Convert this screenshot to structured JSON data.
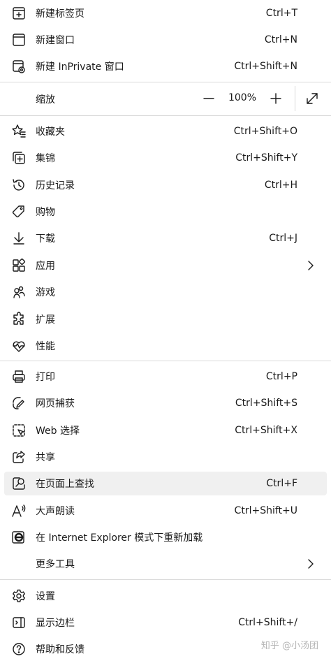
{
  "items": [
    {
      "label": "新建标签页",
      "shortcut": "Ctrl+T",
      "icon": "new-tab-icon"
    },
    {
      "label": "新建窗口",
      "shortcut": "Ctrl+N",
      "icon": "new-window-icon"
    },
    {
      "label": "新建 InPrivate 窗口",
      "shortcut": "Ctrl+Shift+N",
      "icon": "inprivate-icon"
    },
    {
      "label": "收藏夹",
      "shortcut": "Ctrl+Shift+O",
      "icon": "favorites-icon"
    },
    {
      "label": "集锦",
      "shortcut": "Ctrl+Shift+Y",
      "icon": "collections-icon"
    },
    {
      "label": "历史记录",
      "shortcut": "Ctrl+H",
      "icon": "history-icon"
    },
    {
      "label": "购物",
      "shortcut": "",
      "icon": "shopping-tag-icon"
    },
    {
      "label": "下载",
      "shortcut": "Ctrl+J",
      "icon": "download-icon"
    },
    {
      "label": "应用",
      "shortcut": "",
      "icon": "apps-icon"
    },
    {
      "label": "游戏",
      "shortcut": "",
      "icon": "games-icon"
    },
    {
      "label": "扩展",
      "shortcut": "",
      "icon": "extensions-icon"
    },
    {
      "label": "性能",
      "shortcut": "",
      "icon": "performance-icon"
    },
    {
      "label": "打印",
      "shortcut": "Ctrl+P",
      "icon": "print-icon"
    },
    {
      "label": "网页捕获",
      "shortcut": "Ctrl+Shift+S",
      "icon": "web-capture-icon"
    },
    {
      "label": "Web 选择",
      "shortcut": "Ctrl+Shift+X",
      "icon": "web-select-icon"
    },
    {
      "label": "共享",
      "shortcut": "",
      "icon": "share-icon"
    },
    {
      "label": "在页面上查找",
      "shortcut": "Ctrl+F",
      "icon": "find-icon"
    },
    {
      "label": "大声朗读",
      "shortcut": "Ctrl+Shift+U",
      "icon": "read-aloud-icon"
    },
    {
      "label": "在 Internet Explorer 模式下重新加载",
      "shortcut": "",
      "icon": "ie-icon"
    },
    {
      "label": "更多工具",
      "shortcut": "",
      "icon": ""
    },
    {
      "label": "设置",
      "shortcut": "",
      "icon": "settings-icon"
    },
    {
      "label": "显示边栏",
      "shortcut": "Ctrl+Shift+/",
      "icon": "sidebar-icon"
    },
    {
      "label": "帮助和反馈",
      "shortcut": "",
      "icon": "help-icon"
    }
  ],
  "zoom": {
    "label": "缩放",
    "value": "100%",
    "minus": "—",
    "plus": "+"
  },
  "watermark": "知乎 @小汤团"
}
